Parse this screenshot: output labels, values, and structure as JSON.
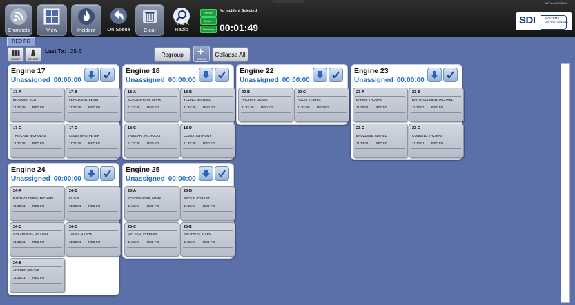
{
  "toolbar": {
    "buttons": [
      {
        "label": "Channels",
        "icon": "wifi-icon"
      },
      {
        "label": "View",
        "icon": "grid-icon"
      },
      {
        "label": "Incident",
        "icon": "fire-icon"
      },
      {
        "label": "On Scene",
        "icon": "return-arrow-icon"
      },
      {
        "label": "Clear",
        "icon": "trash-icon"
      },
      {
        "label": "Find A Radio",
        "icon": "magnifier-icon"
      }
    ],
    "status_indicators": [
      "Server",
      "System",
      "Telemetry"
    ],
    "incident_text": "No Incident Selected",
    "timer": "00:01:49",
    "patent": "US Patent #8,996,011",
    "logo": {
      "brand": "SDI",
      "line1": "SYSTEMS",
      "line2": "DEFINITION INC."
    }
  },
  "group_tab": "RED FG",
  "actions": {
    "group_label": "GROUP",
    "select_label": "SELECT",
    "last_tx_label": "Last Tx:",
    "last_tx_value": "25-E",
    "regroup": "Regroup",
    "create": "CREATE",
    "collapse_all": "Collapse All"
  },
  "panels": [
    {
      "name": "Engine 17",
      "status": "Unassigned",
      "timer": "00:00:00",
      "units": [
        {
          "id": "17-A",
          "name": "BRADLEY, SCOTT",
          "time": "11:31:38",
          "group": "RED FG"
        },
        {
          "id": "17-B",
          "name": "FERGUSON, KEVIN",
          "time": "11:31:38",
          "group": "RED FG"
        },
        {
          "id": "17-C",
          "name": "TRISCARI, NICHOLAS",
          "time": "11:31:38",
          "group": "RED FG"
        },
        {
          "id": "17-D",
          "name": "CELESTINO, PETER",
          "time": "11:31:38",
          "group": "RED FG"
        }
      ]
    },
    {
      "name": "Engine 18",
      "status": "Unassigned",
      "timer": "00:00:00",
      "units": [
        {
          "id": "18-A",
          "name": "SCHOENHERR, MARK",
          "time": "11:31:38",
          "group": "RED FG"
        },
        {
          "id": "18-B",
          "name": "YOUNG, MICHAEL",
          "time": "11:31:38",
          "group": "RED FG"
        },
        {
          "id": "18-C",
          "name": "TRISCARI, NICHOLAS",
          "time": "11:31:38",
          "group": "RED FG"
        },
        {
          "id": "18-D",
          "name": "COSTA, ANTHONY",
          "time": "11:31:38",
          "group": "RED FG"
        }
      ]
    },
    {
      "name": "Engine 22",
      "status": "Unassigned",
      "timer": "00:00:00",
      "units": [
        {
          "id": "22-B",
          "name": "ARCHER, DEANE",
          "time": "11:31:45",
          "group": "RED FG"
        },
        {
          "id": "22-C",
          "name": "AULETTA, ERIC",
          "time": "11:31:45",
          "group": "RED FG"
        }
      ]
    },
    {
      "name": "Engine 23",
      "status": "Unassigned",
      "timer": "00:00:00",
      "units": [
        {
          "id": "23-A",
          "name": "BAKER, THOMAS",
          "time": "11:32:01",
          "group": "RED FG"
        },
        {
          "id": "23-B",
          "name": "BARTHOLOMEW, MICHAEL",
          "time": "11:32:01",
          "group": "RED FG"
        },
        {
          "id": "23-C",
          "name": "BRUZZESE, ALFRED",
          "time": "11:32:01",
          "group": "RED FG"
        },
        {
          "id": "23-E",
          "name": "CONNELL, THOMAS",
          "time": "11:32:01",
          "group": "RED FG"
        }
      ]
    },
    {
      "name": "Engine 24",
      "status": "Unassigned",
      "timer": "00:00:00",
      "units": [
        {
          "id": "24-A",
          "name": "BARTHOLOMEW, MICHAEL",
          "time": "11:32:01",
          "group": "RED FG"
        },
        {
          "id": "24-B",
          "name": "III, III III",
          "time": "11:32:01",
          "group": "RED FG"
        },
        {
          "id": "24-C",
          "name": "COLANGELO, WILLIAM",
          "time": "11:32:01",
          "group": "RED FG"
        },
        {
          "id": "24-D",
          "name": "JAMES, AARON",
          "time": "11:32:01",
          "group": "RED FG"
        },
        {
          "id": "24-E",
          "name": "ARCHER, DEANE",
          "time": "11:32:01",
          "group": "RED FG"
        }
      ]
    },
    {
      "name": "Engine 25",
      "status": "Unassigned",
      "timer": "00:00:00",
      "units": [
        {
          "id": "25-A",
          "name": "SCHOENHERR, MARK",
          "time": "11:32:01",
          "group": "RED FG"
        },
        {
          "id": "25-B",
          "name": "RYDER, ROBERT",
          "time": "11:32:01",
          "group": "RED FG"
        },
        {
          "id": "25-C",
          "name": "MCLEAN, STEPHEN",
          "time": "11:32:01",
          "group": "RED FG"
        },
        {
          "id": "25-E",
          "name": "BRUZZESE, GARY",
          "time": "11:32:01",
          "group": "RED FG"
        }
      ]
    }
  ]
}
